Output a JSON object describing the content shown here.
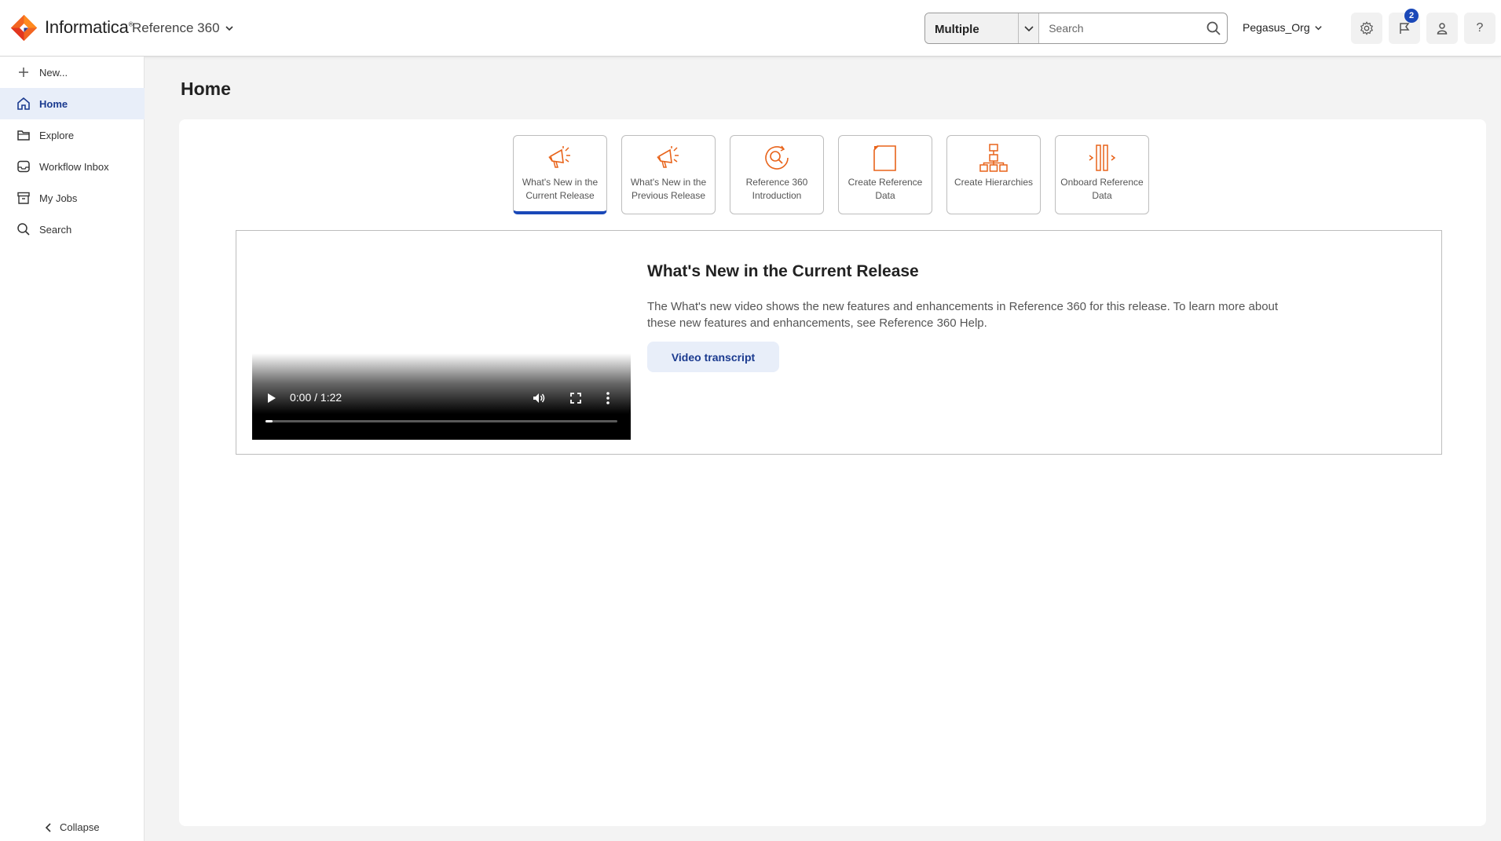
{
  "header": {
    "brand": "Informatica",
    "product": "Reference 360",
    "search_scope": "Multiple",
    "search_placeholder": "Search",
    "org": "Pegasus_Org",
    "notification_count": "2",
    "help_label": "?"
  },
  "sidebar": {
    "items": [
      {
        "label": "New...",
        "icon": "plus-icon"
      },
      {
        "label": "Home",
        "icon": "home-icon"
      },
      {
        "label": "Explore",
        "icon": "folder-icon"
      },
      {
        "label": "Workflow Inbox",
        "icon": "inbox-icon"
      },
      {
        "label": "My Jobs",
        "icon": "archive-icon"
      },
      {
        "label": "Search",
        "icon": "search-icon"
      }
    ],
    "collapse_label": "Collapse"
  },
  "main": {
    "title": "Home",
    "tiles": [
      {
        "label": "What's New in the Current Release",
        "icon": "megaphone-icon",
        "selected": true
      },
      {
        "label": "What's New in the Previous Release",
        "icon": "megaphone-icon",
        "selected": false
      },
      {
        "label": "Reference 360 Introduction",
        "icon": "magnifier-cycle-icon",
        "selected": false
      },
      {
        "label": "Create Reference Data",
        "icon": "document-icon",
        "selected": false
      },
      {
        "label": "Create Hierarchies",
        "icon": "hierarchy-icon",
        "selected": false
      },
      {
        "label": "Onboard Reference Data",
        "icon": "onboard-icon",
        "selected": false
      }
    ],
    "panel": {
      "title": "What's New in the Current Release",
      "description": "The What's new video shows the new features and enhancements in Reference 360 for this release. To learn more about these new features and enhancements, see Reference 360 Help.",
      "button_label": "Video transcript",
      "video_time": "0:00 / 1:22",
      "video_progress": 0.02
    }
  },
  "colors": {
    "accent": "#1a48b8",
    "brand_orange": "#f26522",
    "active_bg": "#e8eef9"
  }
}
